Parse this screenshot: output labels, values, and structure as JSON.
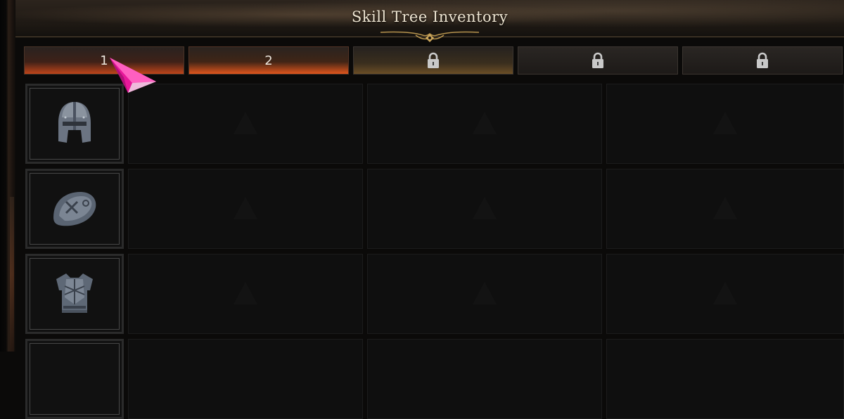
{
  "header": {
    "title": "Skill Tree Inventory"
  },
  "tabs": [
    {
      "label": "1",
      "locked": false,
      "state": "active"
    },
    {
      "label": "2",
      "locked": false,
      "state": "warm"
    },
    {
      "label": "",
      "locked": true,
      "icon": "lock-icon",
      "state": "amber"
    },
    {
      "label": "",
      "locked": true,
      "icon": "lock-icon"
    },
    {
      "label": "",
      "locked": true,
      "icon": "lock-icon"
    }
  ],
  "rows": [
    {
      "slot_icon": "helmet-icon",
      "empty_cells": 3
    },
    {
      "slot_icon": "shoulder-pad-icon",
      "empty_cells": 3
    },
    {
      "slot_icon": "chest-armor-icon",
      "empty_cells": 3
    },
    {
      "slot_icon": "",
      "empty_cells": 3
    }
  ],
  "colors": {
    "active_tab_glow": "#c0451a",
    "warm_tab_glow": "#e0551c",
    "cursor": "#e8189a"
  }
}
